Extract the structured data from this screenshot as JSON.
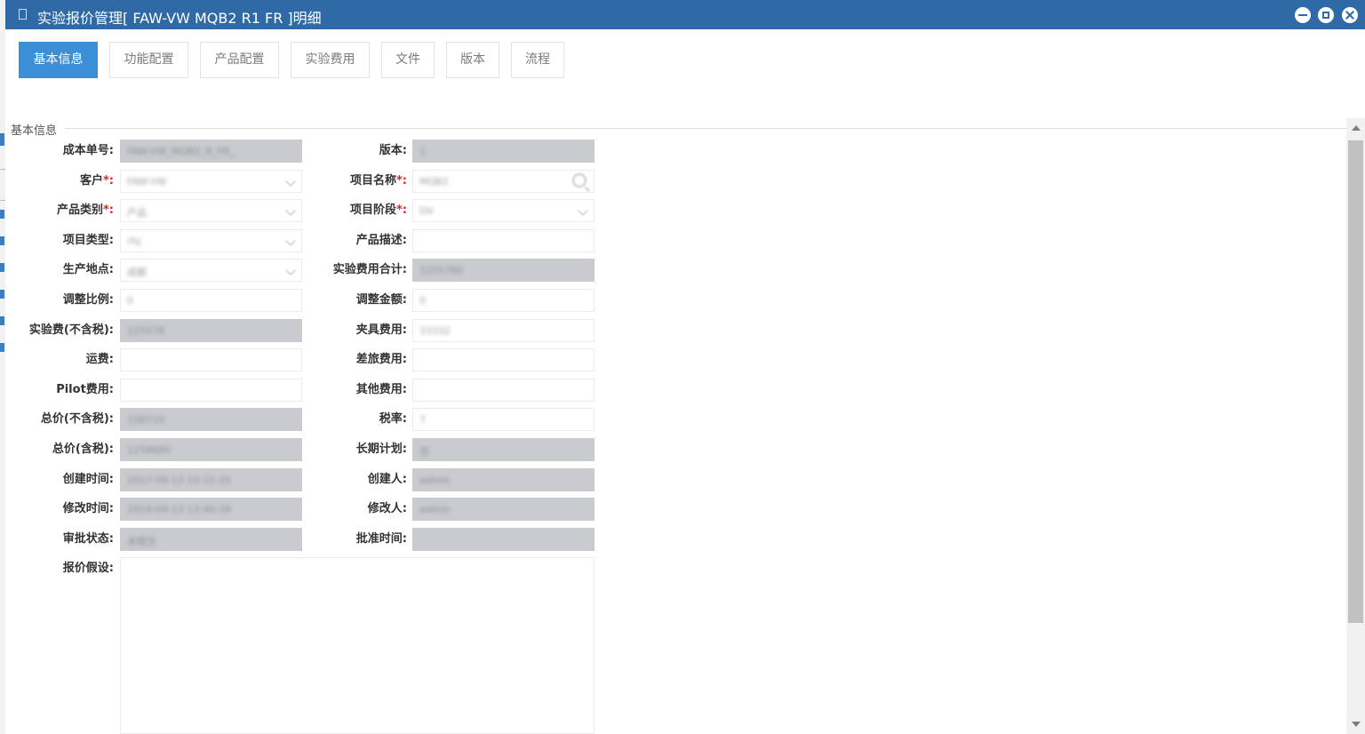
{
  "window": {
    "title": "实验报价管理[ FAW-VW  MQB2 R1 FR ]明细",
    "controls": [
      "minimize-icon",
      "maximize-icon",
      "close-icon"
    ]
  },
  "tabs": [
    {
      "label": "基本信息",
      "active": true
    },
    {
      "label": "功能配置",
      "active": false
    },
    {
      "label": "产品配置",
      "active": false
    },
    {
      "label": "实验费用",
      "active": false
    },
    {
      "label": "文件",
      "active": false
    },
    {
      "label": "版本",
      "active": false
    },
    {
      "label": "流程",
      "active": false
    }
  ],
  "section": {
    "legend": "基本信息"
  },
  "fields": {
    "cost_no": {
      "label": "成本单号:",
      "value": "FAW-VW_MQB2_R_FR_"
    },
    "version": {
      "label": "版本:",
      "value": "1"
    },
    "customer": {
      "label": "客户",
      "value": "FAW-VW"
    },
    "project_name": {
      "label": "项目名称",
      "value": "MQB2"
    },
    "product_category": {
      "label": "产品类别",
      "value": "产品"
    },
    "project_stage": {
      "label": "项目阶段",
      "value": "DV"
    },
    "project_type": {
      "label": "项目类型:",
      "value": "rfq"
    },
    "product_desc": {
      "label": "产品描述:",
      "value": ""
    },
    "production_site": {
      "label": "生产地点:",
      "value": "成都"
    },
    "test_cost_total": {
      "label": "实验费用合计:",
      "value": "1255780"
    },
    "adjust_ratio": {
      "label": "调整比例:",
      "value": "0"
    },
    "adjust_amount": {
      "label": "调整金额:",
      "value": "0"
    },
    "test_cost_excl_tax": {
      "label": "实验费(不含税):",
      "value": "125578"
    },
    "fixture_cost": {
      "label": "夹具费用:",
      "value": "33332"
    },
    "freight": {
      "label": "运费:",
      "value": ""
    },
    "travel_cost": {
      "label": "差旅费用:",
      "value": ""
    },
    "pilot_cost": {
      "label": "Pilot费用:",
      "value": ""
    },
    "other_cost": {
      "label": "其他费用:",
      "value": ""
    },
    "total_excl_tax": {
      "label": "总价(不含税):",
      "value": "158710"
    },
    "tax_rate": {
      "label": "税率:",
      "value": "7"
    },
    "total_incl_tax": {
      "label": "总价(含税):",
      "value": "1258680"
    },
    "long_term_plan": {
      "label": "长期计划:",
      "value": "否"
    },
    "created_time": {
      "label": "创建时间:",
      "value": "2017-09-13 10:15:35"
    },
    "creator": {
      "label": "创建人:",
      "value": "admin"
    },
    "modified_time": {
      "label": "修改时间:",
      "value": "2018-09-13 13:40:39"
    },
    "modifier": {
      "label": "修改人:",
      "value": "admin"
    },
    "approval_status": {
      "label": "审批状态:",
      "value": "未提交"
    },
    "approval_time": {
      "label": "批准时间:",
      "value": ""
    },
    "quote_assumption": {
      "label": "报价假设:",
      "value": ""
    }
  },
  "required_mark": "*:",
  "colors": {
    "titlebar": "#2f6aa7",
    "active_tab": "#3b8fd6",
    "readonly_field": "#c9cbce",
    "required": "#d9232d"
  }
}
